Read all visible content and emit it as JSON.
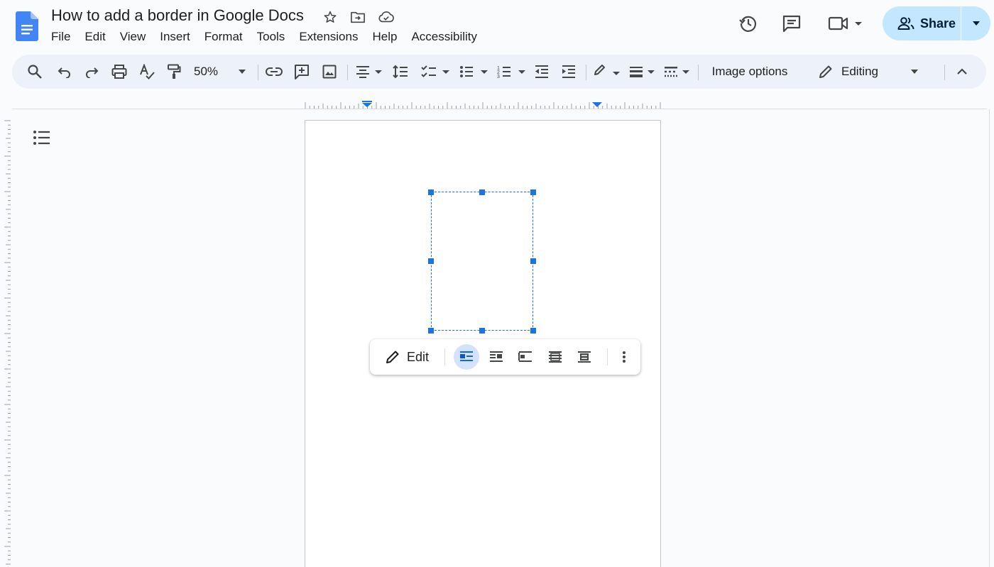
{
  "app": {
    "title": "How to add a border in Google Docs",
    "menu": [
      "File",
      "Edit",
      "View",
      "Insert",
      "Format",
      "Tools",
      "Extensions",
      "Help",
      "Accessibility"
    ],
    "icons": {
      "logo": "docs-logo-icon",
      "star": "star-icon",
      "move": "move-to-folder-icon",
      "cloud": "cloud-saved-icon",
      "history": "version-history-icon",
      "comments": "comments-icon",
      "meet": "meet-camera-icon"
    },
    "accent_color": "#1a73e8"
  },
  "share": {
    "label": "Share",
    "background": "#c2e7ff"
  },
  "toolbar": {
    "zoom": "50%",
    "image_options": "Image options",
    "mode": "Editing"
  },
  "image_toolbar": {
    "edit_label": "Edit",
    "selected_wrap": "inline"
  }
}
